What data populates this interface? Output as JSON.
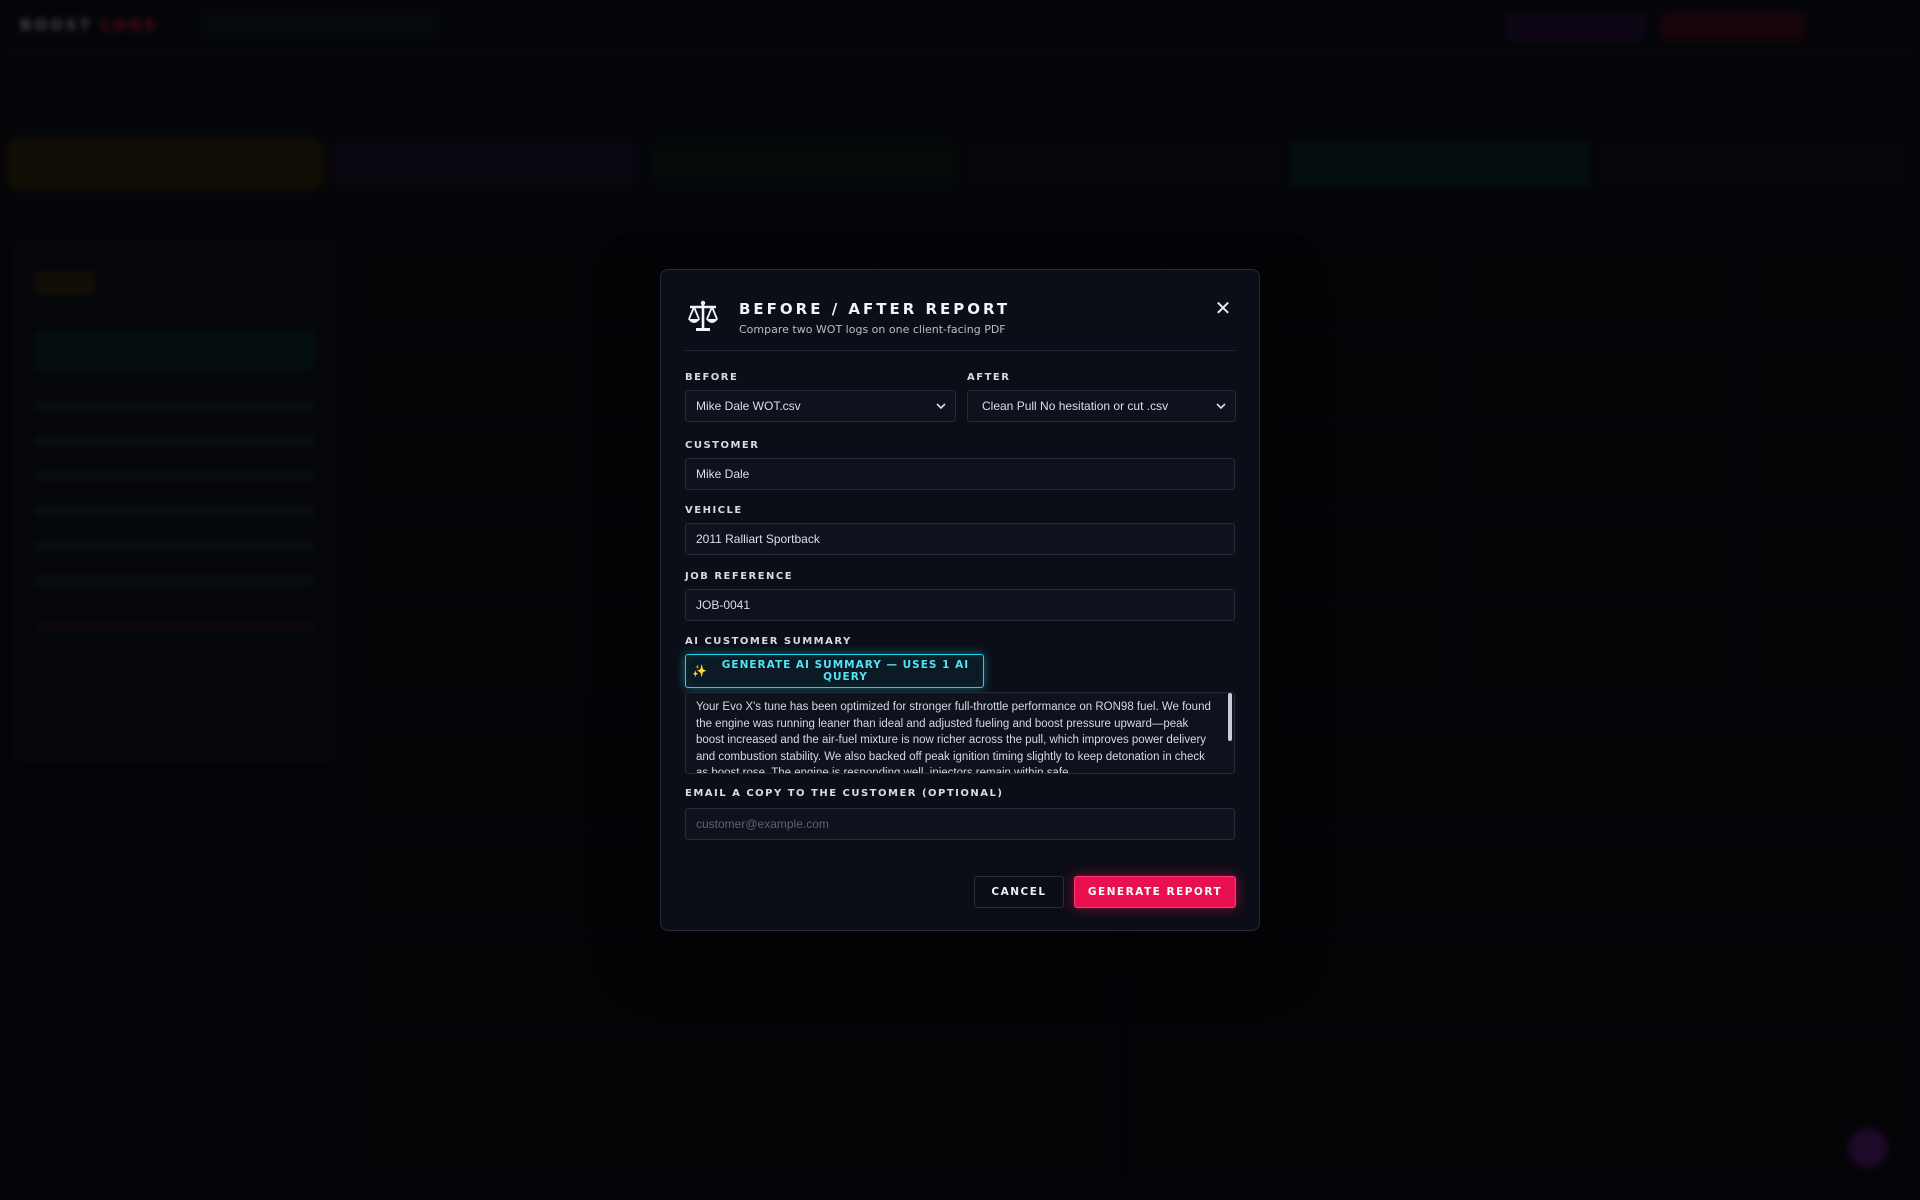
{
  "background_app": {
    "logo_part1": "BOOST",
    "logo_part2": "LOGS"
  },
  "modal": {
    "title": "BEFORE / AFTER REPORT",
    "subtitle": "Compare two WOT logs on one client-facing PDF",
    "icon": "scale-balance-icon",
    "close_icon": "close-icon",
    "close_glyph": "✕",
    "before": {
      "label": "BEFORE",
      "value": "Mike Dale WOT.csv"
    },
    "after": {
      "label": "AFTER",
      "value": "Clean Pull No hesitation or cut .csv"
    },
    "customer": {
      "label": "CUSTOMER",
      "value": "Mike Dale"
    },
    "vehicle": {
      "label": "VEHICLE",
      "value": "2011 Ralliart Sportback"
    },
    "job_reference": {
      "label": "JOB REFERENCE",
      "value": "JOB-0041"
    },
    "ai_summary": {
      "label": "AI CUSTOMER SUMMARY",
      "button_icon": "✨",
      "button_label": "GENERATE AI SUMMARY — USES 1 AI QUERY",
      "text": "Your Evo X's tune has been optimized for stronger full-throttle performance on RON98 fuel. We found the engine was running leaner than ideal and adjusted fueling and boost pressure upward—peak boost increased and the air-fuel mixture is now richer across the pull, which improves power delivery and combustion stability. We also backed off peak ignition timing slightly to keep detonation in check as boost rose. The engine is responding well, injectors remain within safe"
    },
    "email": {
      "label": "EMAIL A COPY TO THE CUSTOMER (OPTIONAL)",
      "placeholder": "customer@example.com"
    },
    "cancel_label": "CANCEL",
    "generate_label": "GENERATE REPORT"
  },
  "colors": {
    "accent_cyan": "#1fd0ea",
    "accent_red": "#e8104f",
    "modal_bg": "#0c0e17"
  }
}
